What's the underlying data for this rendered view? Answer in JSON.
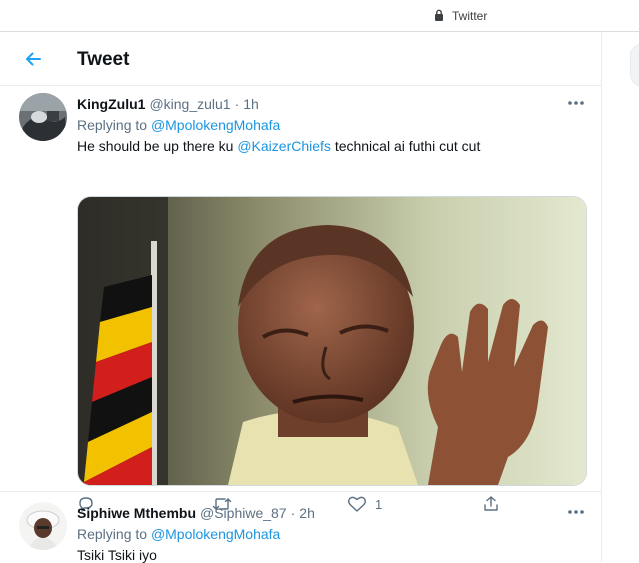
{
  "browser": {
    "site_label": "Twitter",
    "lock_icon": "lock-icon"
  },
  "header": {
    "title": "Tweet",
    "back_icon": "arrow-left-icon"
  },
  "colors": {
    "accent": "#1da1f2",
    "link": "#1b95e0",
    "muted": "#5b7083",
    "divider": "#e6ecf0"
  },
  "tweets": [
    {
      "display_name": "KingZulu1",
      "handle": "@king_zulu1",
      "separator": "·",
      "time": "1h",
      "replying_prefix": "Replying to",
      "replying_to": "@MpolokengMohafa",
      "text_before": "He should be up there ku",
      "text_mention": "@KaizerChiefs",
      "text_after": "technical ai futhi cut cut",
      "has_image": true,
      "actions": {
        "reply": {
          "icon": "reply-icon",
          "count": ""
        },
        "retweet": {
          "icon": "retweet-icon",
          "count": ""
        },
        "like": {
          "icon": "heart-icon",
          "count": "1"
        },
        "share": {
          "icon": "share-icon",
          "count": ""
        }
      }
    },
    {
      "display_name": "Siphiwe Mthembu",
      "handle": "@Siphiwe_87",
      "separator": "·",
      "time": "2h",
      "replying_prefix": "Replying to",
      "replying_to": "@MpolokengMohafa",
      "text": "Tsiki Tsiki iyo"
    }
  ]
}
